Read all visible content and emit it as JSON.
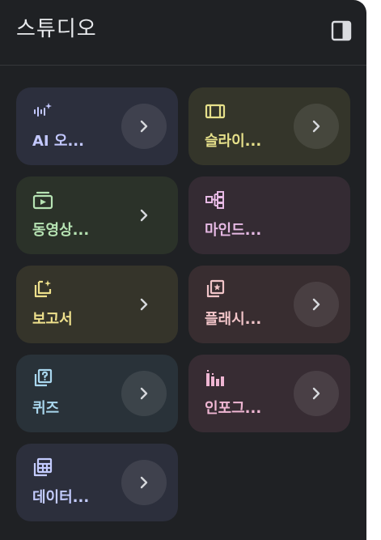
{
  "header": {
    "title": "스튜디오",
    "collapse_icon": "side-panel-icon"
  },
  "colors": {
    "panel_background": "#1f2124",
    "title_text": "#e8eaed"
  },
  "cards": [
    {
      "id": "audio",
      "label": "AI 오...",
      "icon": "audio-waveform-sparkle-icon",
      "accent": "#c3c8ff",
      "arrow_highlighted": true
    },
    {
      "id": "slides",
      "label": "슬라이...",
      "icon": "slides-icon",
      "accent": "#e6e08a",
      "arrow_highlighted": true
    },
    {
      "id": "video",
      "label": "동영상...",
      "icon": "video-overview-icon",
      "accent": "#b6e3b3",
      "arrow_highlighted": false
    },
    {
      "id": "mindmap",
      "label": "마인드...",
      "icon": "mind-map-icon",
      "accent": "#e6b9e4",
      "arrow_highlighted": false
    },
    {
      "id": "report",
      "label": "보고서",
      "icon": "report-sparkle-icon",
      "accent": "#eee08c",
      "arrow_highlighted": false
    },
    {
      "id": "flashcards",
      "label": "플래시...",
      "icon": "flashcards-icon",
      "accent": "#f1c4c8",
      "arrow_highlighted": true
    },
    {
      "id": "quiz",
      "label": "퀴즈",
      "icon": "quiz-icon",
      "accent": "#a9d7ee",
      "arrow_highlighted": true
    },
    {
      "id": "infographic",
      "label": "인포그...",
      "icon": "infographic-icon",
      "accent": "#efb6d3",
      "arrow_highlighted": true
    },
    {
      "id": "datatable",
      "label": "데이터...",
      "icon": "data-table-icon",
      "accent": "#c4ccff",
      "arrow_highlighted": true
    }
  ]
}
